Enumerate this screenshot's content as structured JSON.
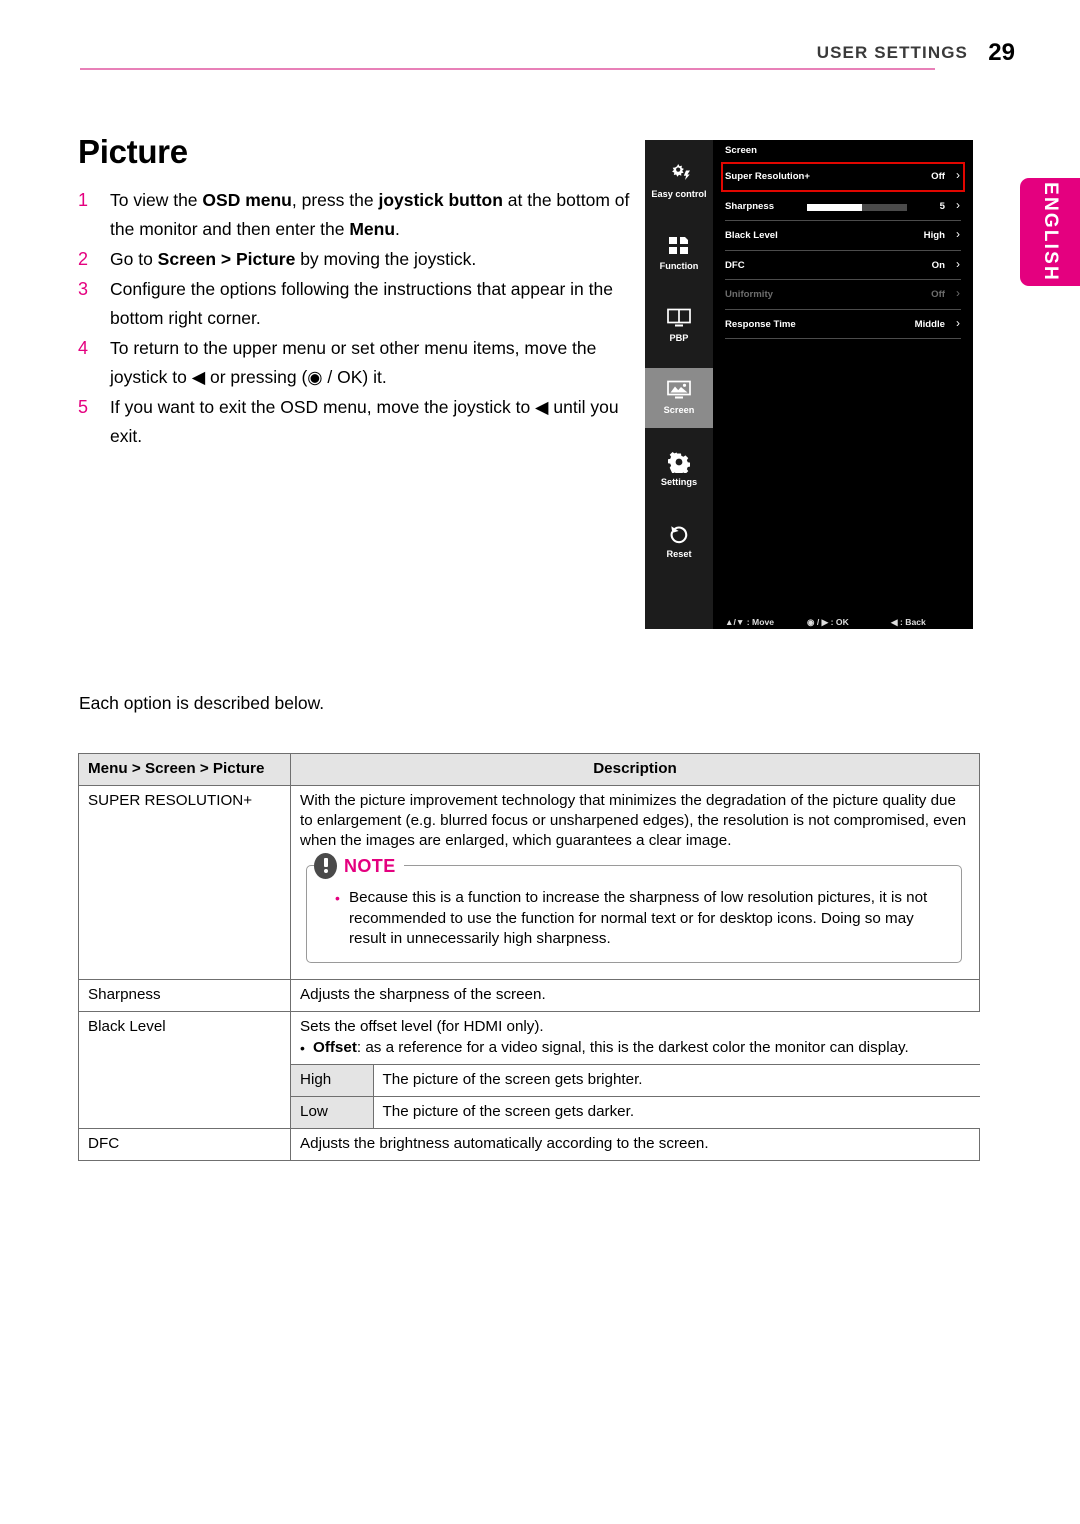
{
  "header": {
    "label": "USER SETTINGS",
    "page_number": "29",
    "rule_color": "#e880b8"
  },
  "language_tab": {
    "label": "ENGLISH",
    "color": "#e4007f"
  },
  "section": {
    "title": "Picture",
    "each_option_note": "Each option is described below."
  },
  "steps": [
    {
      "num": "1",
      "html": "To view the <b>OSD menu</b>, press the <b>joystick button</b> at the bottom of the monitor and then enter the <b>Menu</b>."
    },
    {
      "num": "2",
      "html": "Go to <b>Screen &gt; Picture</b> by moving the joystick."
    },
    {
      "num": "3",
      "html": "Configure the options following the instructions that appear in the bottom right corner."
    },
    {
      "num": "4",
      "html": "To return to the upper menu or set other menu items, move the joystick to ◀ or pressing (◉ / OK) it."
    },
    {
      "num": "5",
      "html": "If you want to exit the OSD menu, move the joystick to ◀ until you exit."
    }
  ],
  "osd": {
    "panel_title": "Screen",
    "rail": [
      {
        "label": "Easy control",
        "icon": "brightness-gear-icon",
        "active": false
      },
      {
        "label": "Function",
        "icon": "function-blocks-icon",
        "active": false
      },
      {
        "label": "PBP",
        "icon": "pbp-split-screen-icon",
        "active": false
      },
      {
        "label": "Screen",
        "icon": "screen-picture-icon",
        "active": true
      },
      {
        "label": "Settings",
        "icon": "gear-icon",
        "active": false
      },
      {
        "label": "Reset",
        "icon": "reset-arrow-icon",
        "active": false
      }
    ],
    "rows": [
      {
        "label": "Super Resolution+",
        "value": "Off",
        "type": "value",
        "dim": false,
        "selected": true
      },
      {
        "label": "Sharpness",
        "value": "5",
        "type": "slider",
        "slider_percent": 55,
        "dim": false,
        "selected": false
      },
      {
        "label": "Black Level",
        "value": "High",
        "type": "value",
        "dim": false,
        "selected": false
      },
      {
        "label": "DFC",
        "value": "On",
        "type": "value",
        "dim": false,
        "selected": false
      },
      {
        "label": "Uniformity",
        "value": "Off",
        "type": "value",
        "dim": true,
        "selected": false
      },
      {
        "label": "Response Time",
        "value": "Middle",
        "type": "value",
        "dim": false,
        "selected": false
      }
    ],
    "hints": [
      "▲/▼ : Move",
      "◉ / ▶ : OK",
      "◀ : Back"
    ],
    "highlight_color": "#e10600"
  },
  "table": {
    "headers": {
      "col_menu": "Menu > Screen > Picture",
      "col_description": "Description"
    },
    "rows": [
      {
        "name": "SUPER RESOLUTION+",
        "description": "With the picture improvement technology that minimizes the degradation of the picture quality due to enlargement (e.g. blurred focus or unsharpened edges), the resolution is not compromised, even when the images are enlarged, which guarantees a clear image.",
        "note": {
          "title": "NOTE",
          "bullet": "Because this is a function to increase the sharpness of low resolution pictures, it is not recommended to use the function for normal text or for desktop icons. Doing so may result in unnecessarily high sharpness."
        }
      },
      {
        "name": "Sharpness",
        "description": "Adjusts the sharpness of the screen."
      },
      {
        "name": "Black Level",
        "description": "Sets the offset level (for HDMI only).",
        "bullet_label": "Offset",
        "bullet_rest": ": as a reference for a video signal, this is the darkest color the monitor can display.",
        "sub_rows": [
          {
            "name": "High",
            "description": "The picture of the screen gets brighter."
          },
          {
            "name": "Low",
            "description": "The picture of the screen gets darker."
          }
        ]
      },
      {
        "name": "DFC",
        "description": "Adjusts the brightness automatically according to the screen."
      }
    ]
  }
}
